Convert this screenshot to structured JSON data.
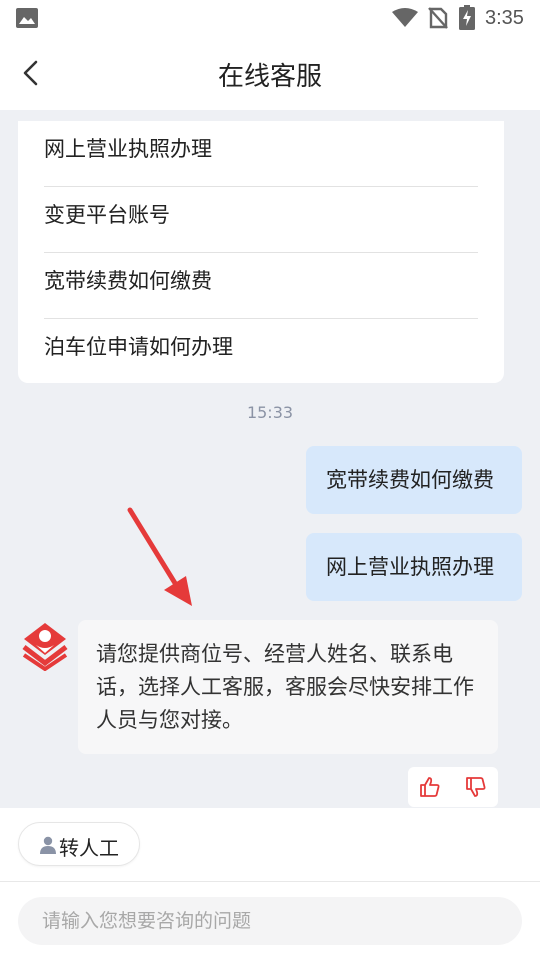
{
  "status_bar": {
    "time": "3:35"
  },
  "header": {
    "title": "在线客服"
  },
  "quick_questions": [
    "网上营业执照办理",
    "变更平台账号",
    "宽带续费如何缴费",
    "泊车位申请如何办理"
  ],
  "chat": {
    "timestamp": "15:33",
    "user_messages": [
      "宽带续费如何缴费",
      "网上营业执照办理"
    ],
    "agent_message": "请您提供商位号、经营人姓名、联系电话，选择人工客服，客服会尽快安排工作人员与您对接。"
  },
  "bottom": {
    "transfer_label": "转人工",
    "input_placeholder": "请输入您想要咨询的问题"
  },
  "colors": {
    "accent_red": "#e53a3a",
    "user_bubble": "#d7e8fb",
    "background": "#eef0f4"
  }
}
